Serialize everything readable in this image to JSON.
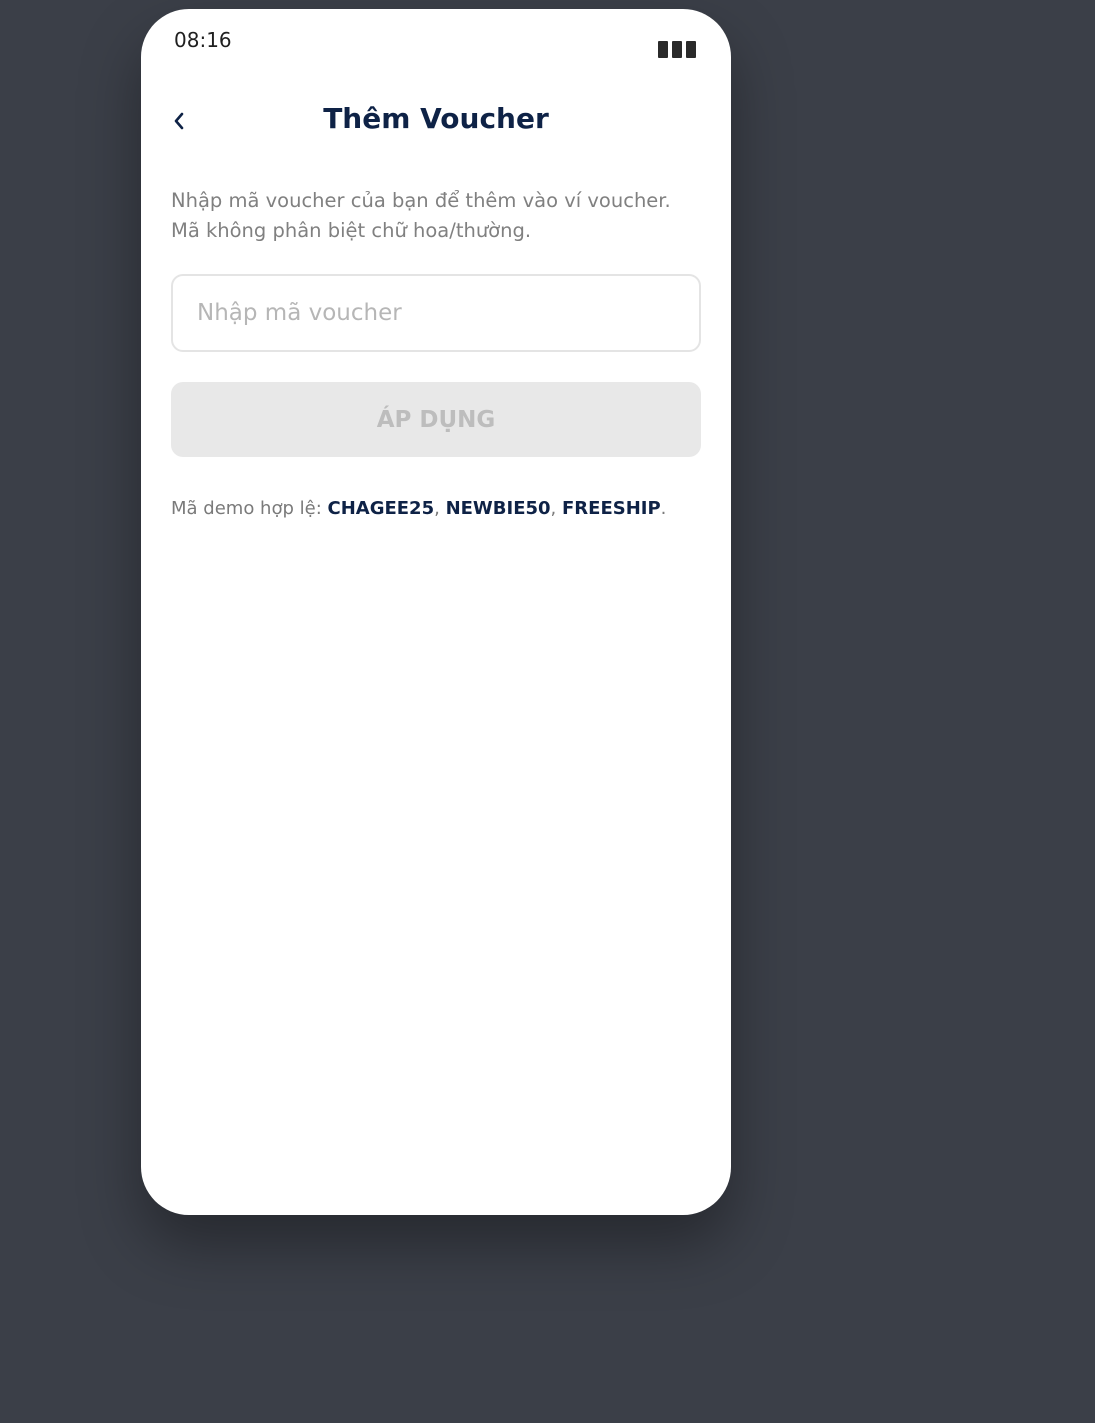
{
  "status_bar": {
    "time": "08:16",
    "battery_icon": "battery-icon"
  },
  "header": {
    "back_icon": "chevron-left-icon",
    "back_glyph": "‹",
    "title": "Thêm Voucher"
  },
  "description": {
    "line1": "Nhập mã voucher của bạn để thêm vào ví voucher.",
    "line2": "Mã không phân biệt chữ hoa/thường."
  },
  "voucher_input": {
    "value": "",
    "placeholder": "Nhập mã voucher"
  },
  "apply_button": {
    "label": "ÁP DỤNG",
    "enabled": false
  },
  "demo": {
    "prefix": "Mã demo hợp lệ: ",
    "codes": [
      "CHAGEE25",
      "NEWBIE50",
      "FREESHIP"
    ],
    "separator": ", ",
    "suffix": "."
  },
  "colors": {
    "background": "#3b3f48",
    "accent": "#0e2246",
    "muted_text": "#808080",
    "disabled_button_bg": "#e8e8e8",
    "disabled_button_text": "#bdbdbd"
  }
}
